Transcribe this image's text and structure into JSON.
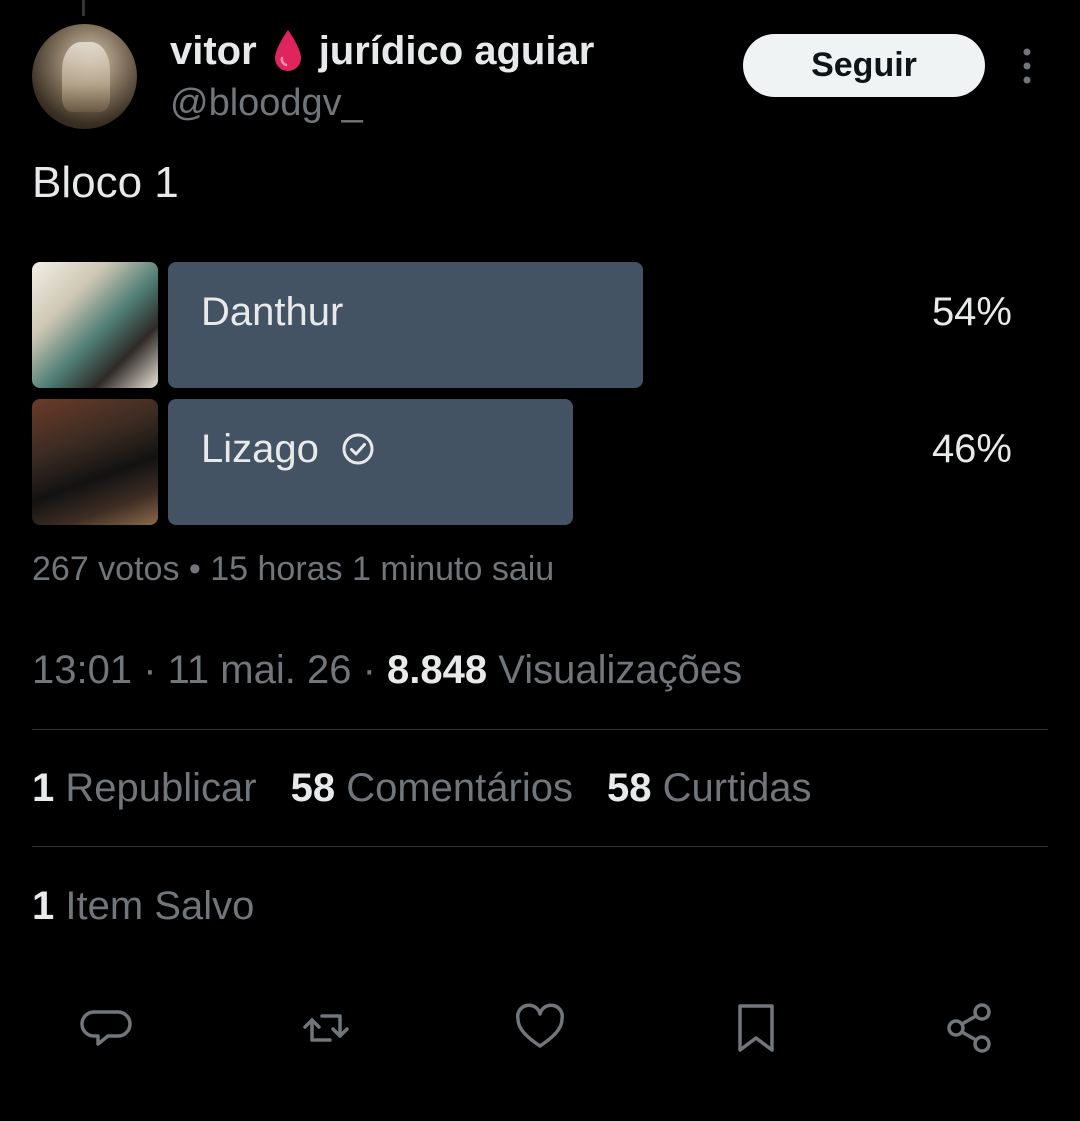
{
  "author": {
    "display_name_first": "vitor",
    "display_name_second": "jurídico aguiar",
    "handle": "@bloodgv_",
    "name_emoji": "drop-of-blood-icon"
  },
  "follow_label": "Seguir",
  "post_text": "Bloco 1",
  "poll": {
    "options": [
      {
        "label": "Danthur",
        "percent_label": "54%",
        "percent": 54,
        "selected": false
      },
      {
        "label": "Lizago",
        "percent_label": "46%",
        "percent": 46,
        "selected": true
      }
    ],
    "meta": "267 votos • 15 horas 1 minuto saiu",
    "bar_color": "#435364"
  },
  "timestamp": {
    "time_date": "13:01 · 11 mai. 26 ·",
    "views_count": "8.848",
    "views_label": "Visualizações"
  },
  "stats": [
    {
      "count": "1",
      "label": "Republicar"
    },
    {
      "count": "58",
      "label": "Comentários"
    },
    {
      "count": "58",
      "label": "Curtidas"
    }
  ],
  "saved": {
    "count": "1",
    "label": "Item Salvo"
  },
  "actions": [
    "reply-icon",
    "repost-icon",
    "like-icon",
    "bookmark-icon",
    "share-icon"
  ],
  "colors": {
    "background": "#000000",
    "text": "#e7e9ea",
    "secondary": "#71767b",
    "accent_drop": "#e0245e"
  }
}
